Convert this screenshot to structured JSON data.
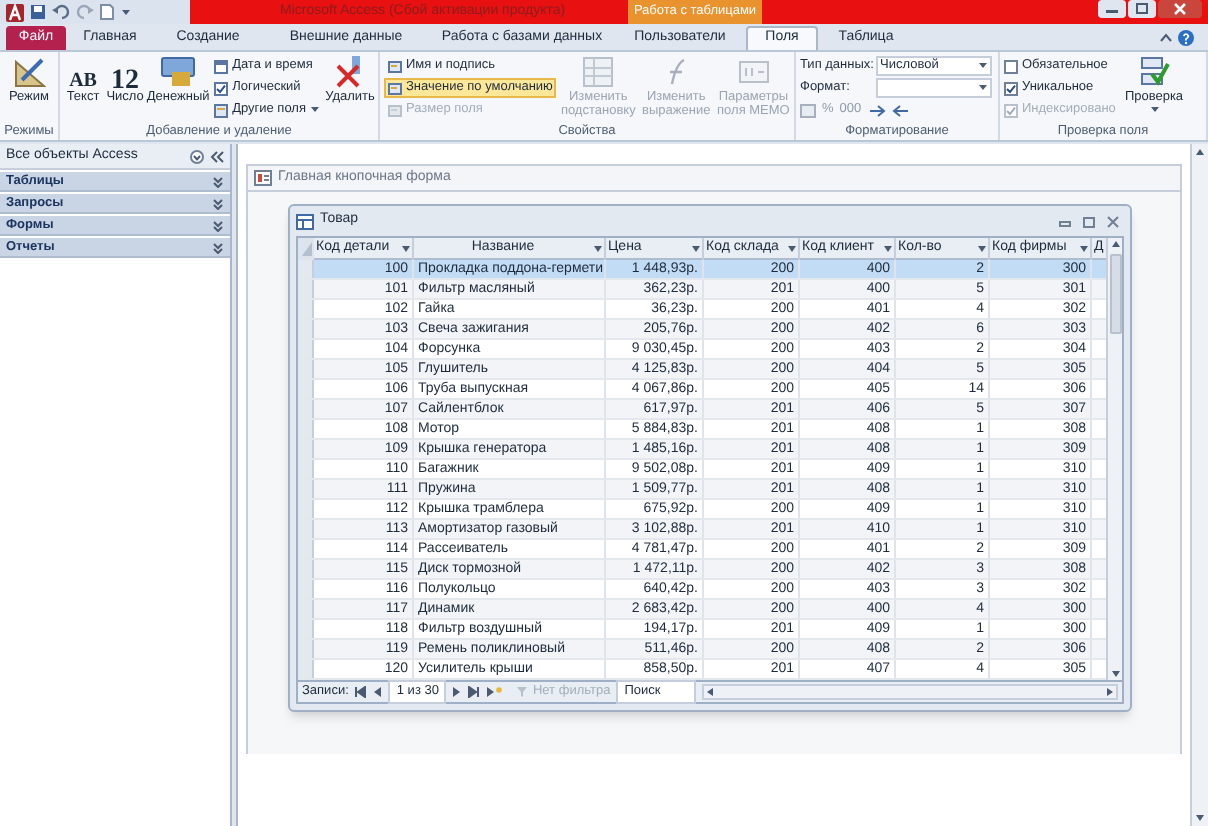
{
  "title_bar": {
    "title": "Microsoft Access (Сбой активации продукта)",
    "context_label": "Работа с таблицами"
  },
  "ribbon_tabs": [
    {
      "label": "Файл",
      "kind": "file",
      "selected": false
    },
    {
      "label": "Главная",
      "kind": "tab",
      "selected": false
    },
    {
      "label": "Создание",
      "kind": "tab",
      "selected": false
    },
    {
      "label": "Внешние данные",
      "kind": "tab",
      "selected": false
    },
    {
      "label": "Работа с базами данных",
      "kind": "tab",
      "selected": false
    },
    {
      "label": "Пользователи",
      "kind": "tab",
      "selected": false
    },
    {
      "label": "Поля",
      "kind": "tab",
      "selected": true
    },
    {
      "label": "Таблица",
      "kind": "tab",
      "selected": false
    }
  ],
  "ribbon": {
    "views": {
      "button": "Режим",
      "group": "Режимы"
    },
    "add_delete": {
      "group": "Добавление и удаление",
      "buttons": [
        {
          "glyph": "AB",
          "label": "Текст"
        },
        {
          "glyph": "12",
          "label": "Число"
        },
        {
          "label": "Денежный"
        }
      ],
      "small": [
        "Дата и время",
        "Логический",
        "Другие поля"
      ],
      "delete": "Удалить"
    },
    "properties": {
      "group": "Свойства",
      "small": [
        {
          "label": "Имя и подпись",
          "highlighted": false,
          "disabled": false
        },
        {
          "label": "Значение по умолчанию",
          "highlighted": true,
          "disabled": false
        },
        {
          "label": "Размер поля",
          "highlighted": false,
          "disabled": true
        }
      ],
      "large": [
        {
          "label": "Изменить подстановку",
          "disabled": true
        },
        {
          "label": "Изменить выражение",
          "disabled": true
        },
        {
          "label": "Параметры поля MEMO",
          "disabled": true
        }
      ]
    },
    "formatting": {
      "group": "Форматирование",
      "data_type_label": "Тип данных:",
      "data_type": "Числовой",
      "format_label": "Формат:",
      "percent": "%",
      "thousands": "000"
    },
    "validation": {
      "group": "Проверка поля",
      "checks": [
        {
          "label": "Обязательное",
          "checked": false,
          "disabled": false
        },
        {
          "label": "Уникальное",
          "checked": true,
          "disabled": false
        },
        {
          "label": "Индексировано",
          "checked": true,
          "disabled": true
        }
      ],
      "button": "Проверка"
    }
  },
  "nav_pane": {
    "title": "Все объекты Access",
    "sections": [
      "Таблицы",
      "Запросы",
      "Формы",
      "Отчеты"
    ]
  },
  "form_tab": {
    "title": "Главная кнопочная форма"
  },
  "datasheet": {
    "title": "Товар",
    "columns": [
      "Код детали",
      "Название",
      "Цена",
      "Код склада",
      "Код клиент",
      "Кол-во",
      "Код фирмы",
      "Д"
    ],
    "rows": [
      {
        "cells": [
          "100",
          "Прокладка поддона-гермети",
          "1 448,93р.",
          "200",
          "400",
          "2",
          "300"
        ],
        "selected": true
      },
      {
        "cells": [
          "101",
          "Фильтр масляный",
          "362,23р.",
          "201",
          "400",
          "5",
          "301"
        ],
        "selected": false
      },
      {
        "cells": [
          "102",
          "Гайка",
          "36,23р.",
          "200",
          "401",
          "4",
          "302"
        ],
        "selected": false
      },
      {
        "cells": [
          "103",
          "Свеча зажигания",
          "205,76р.",
          "200",
          "402",
          "6",
          "303"
        ],
        "selected": false
      },
      {
        "cells": [
          "104",
          "Форсунка",
          "9 030,45р.",
          "200",
          "403",
          "2",
          "304"
        ],
        "selected": false
      },
      {
        "cells": [
          "105",
          "Глушитель",
          "4 125,83р.",
          "200",
          "404",
          "5",
          "305"
        ],
        "selected": false
      },
      {
        "cells": [
          "106",
          "Труба выпускная",
          "4 067,86р.",
          "200",
          "405",
          "14",
          "306"
        ],
        "selected": false
      },
      {
        "cells": [
          "107",
          "Сайлентблок",
          "617,97р.",
          "201",
          "406",
          "5",
          "307"
        ],
        "selected": false
      },
      {
        "cells": [
          "108",
          "Мотор",
          "5 884,83р.",
          "201",
          "408",
          "1",
          "308"
        ],
        "selected": false
      },
      {
        "cells": [
          "109",
          "Крышка генератора",
          "1 485,16р.",
          "201",
          "408",
          "1",
          "309"
        ],
        "selected": false
      },
      {
        "cells": [
          "110",
          "Багажник",
          "9 502,08р.",
          "201",
          "409",
          "1",
          "310"
        ],
        "selected": false
      },
      {
        "cells": [
          "111",
          "Пружина",
          "1 509,77р.",
          "201",
          "408",
          "1",
          "310"
        ],
        "selected": false
      },
      {
        "cells": [
          "112",
          "Крышка трамблера",
          "675,92р.",
          "200",
          "409",
          "1",
          "310"
        ],
        "selected": false
      },
      {
        "cells": [
          "113",
          "Амортизатор газовый",
          "3 102,88р.",
          "201",
          "410",
          "1",
          "310"
        ],
        "selected": false
      },
      {
        "cells": [
          "114",
          "Рассеиватель",
          "4 781,47р.",
          "200",
          "401",
          "2",
          "309"
        ],
        "selected": false
      },
      {
        "cells": [
          "115",
          "Диск тормозной",
          "1 472,11р.",
          "200",
          "402",
          "3",
          "308"
        ],
        "selected": false
      },
      {
        "cells": [
          "116",
          "Полукольцо",
          "640,42р.",
          "200",
          "403",
          "3",
          "302"
        ],
        "selected": false
      },
      {
        "cells": [
          "117",
          "Динамик",
          "2 683,42р.",
          "200",
          "400",
          "4",
          "300"
        ],
        "selected": false
      },
      {
        "cells": [
          "118",
          "Фильтр воздушный",
          "194,17р.",
          "201",
          "409",
          "1",
          "300"
        ],
        "selected": false
      },
      {
        "cells": [
          "119",
          "Ремень поликлиновый",
          "511,46р.",
          "200",
          "408",
          "2",
          "306"
        ],
        "selected": false
      },
      {
        "cells": [
          "120",
          "Усилитель крыши",
          "858,50р.",
          "201",
          "407",
          "4",
          "305"
        ],
        "selected": false
      }
    ],
    "records": {
      "label": "Записи:",
      "position": "1 из 30",
      "filter": "Нет фильтра",
      "search": "Поиск"
    }
  }
}
